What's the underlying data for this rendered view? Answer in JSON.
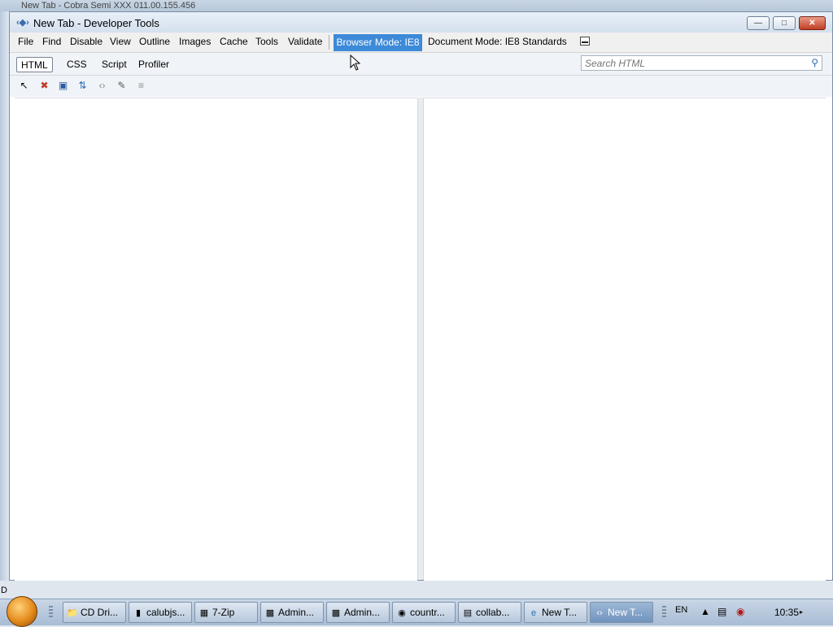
{
  "background": {
    "title_text": "New Tab - Cobra Semi XXX 011.00.155.456",
    "left_letter": "D"
  },
  "window": {
    "title": "New Tab - Developer Tools",
    "icon": "developer-tools-icon",
    "buttons": {
      "minimize": "minimize-icon",
      "maximize": "maximize-icon",
      "close": "close-icon"
    }
  },
  "menubar": {
    "items": [
      "File",
      "Find",
      "Disable",
      "View",
      "Outline",
      "Images",
      "Cache",
      "Tools",
      "Validate"
    ],
    "browser_mode": "Browser Mode: IE8",
    "document_mode": "Document Mode: IE8 Standards"
  },
  "tabs": [
    "HTML",
    "CSS",
    "Script",
    "Profiler"
  ],
  "active_tab": "HTML",
  "search": {
    "placeholder": "Search HTML",
    "value": ""
  },
  "toolbar": [
    "select-element-icon",
    "clear-icon",
    "save-icon",
    "refresh-icon",
    "view-source-icon",
    "edit-icon",
    "word-wrap-icon"
  ],
  "taskbar": {
    "items": [
      {
        "label": "CD Dri...",
        "icon": "folder-icon"
      },
      {
        "label": "calubjs...",
        "icon": "book-icon"
      },
      {
        "label": "7-Zip",
        "icon": "archive-icon"
      },
      {
        "label": "Admin...",
        "icon": "terminal-icon"
      },
      {
        "label": "Admin...",
        "icon": "terminal-icon"
      },
      {
        "label": "countr...",
        "icon": "browser-icon"
      },
      {
        "label": "collab...",
        "icon": "document-icon"
      },
      {
        "label": "New T...",
        "icon": "ie-icon"
      },
      {
        "label": "New T...",
        "icon": "developer-tools-icon"
      }
    ],
    "language": "EN",
    "clock": "10:35"
  },
  "colors": {
    "browser_mode_bg": "#3c8ad8",
    "close_button": "#c13e24",
    "title_bar": "#d4e0ee"
  }
}
